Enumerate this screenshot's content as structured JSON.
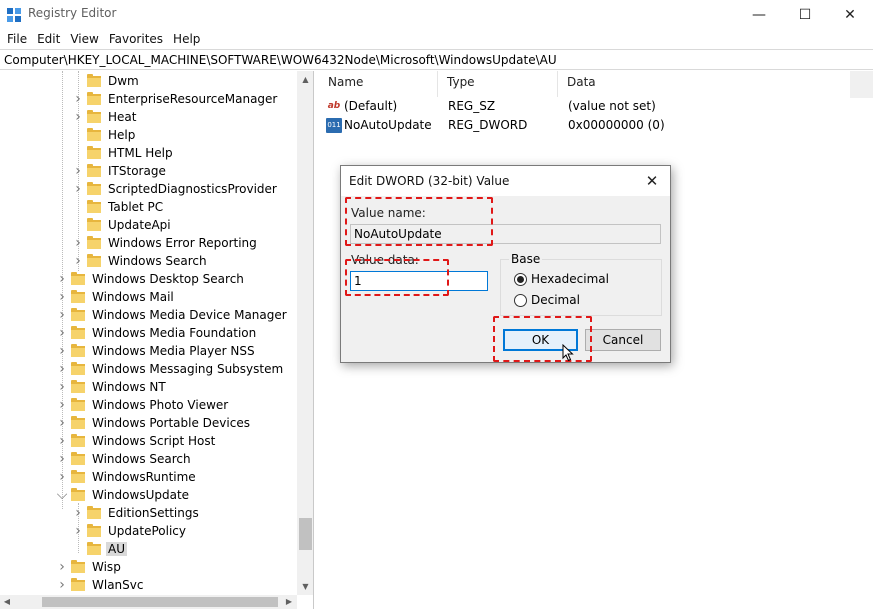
{
  "window": {
    "title": "Registry Editor",
    "minimize_glyph": "—",
    "maximize_glyph": "☐",
    "close_glyph": "✕"
  },
  "menu": [
    "File",
    "Edit",
    "View",
    "Favorites",
    "Help"
  ],
  "address": "Computer\\HKEY_LOCAL_MACHINE\\SOFTWARE\\WOW6432Node\\Microsoft\\WindowsUpdate\\AU",
  "tree": [
    {
      "label": "Dwm",
      "depth": 2,
      "expandable": false
    },
    {
      "label": "EnterpriseResourceManager",
      "depth": 2,
      "expandable": true
    },
    {
      "label": "Heat",
      "depth": 2,
      "expandable": true
    },
    {
      "label": "Help",
      "depth": 2,
      "expandable": false
    },
    {
      "label": "HTML Help",
      "depth": 2,
      "expandable": false
    },
    {
      "label": "ITStorage",
      "depth": 2,
      "expandable": true
    },
    {
      "label": "ScriptedDiagnosticsProvider",
      "depth": 2,
      "expandable": true
    },
    {
      "label": "Tablet PC",
      "depth": 2,
      "expandable": false
    },
    {
      "label": "UpdateApi",
      "depth": 2,
      "expandable": false
    },
    {
      "label": "Windows Error Reporting",
      "depth": 2,
      "expandable": true
    },
    {
      "label": "Windows Search",
      "depth": 2,
      "expandable": true
    },
    {
      "label": "Windows Desktop Search",
      "depth": 1,
      "expandable": true
    },
    {
      "label": "Windows Mail",
      "depth": 1,
      "expandable": true
    },
    {
      "label": "Windows Media Device Manager",
      "depth": 1,
      "expandable": true
    },
    {
      "label": "Windows Media Foundation",
      "depth": 1,
      "expandable": true
    },
    {
      "label": "Windows Media Player NSS",
      "depth": 1,
      "expandable": true
    },
    {
      "label": "Windows Messaging Subsystem",
      "depth": 1,
      "expandable": true
    },
    {
      "label": "Windows NT",
      "depth": 1,
      "expandable": true
    },
    {
      "label": "Windows Photo Viewer",
      "depth": 1,
      "expandable": true
    },
    {
      "label": "Windows Portable Devices",
      "depth": 1,
      "expandable": true
    },
    {
      "label": "Windows Script Host",
      "depth": 1,
      "expandable": true
    },
    {
      "label": "Windows Search",
      "depth": 1,
      "expandable": true
    },
    {
      "label": "WindowsRuntime",
      "depth": 1,
      "expandable": true
    },
    {
      "label": "WindowsUpdate",
      "depth": 1,
      "expandable": true,
      "expanded": true
    },
    {
      "label": "EditionSettings",
      "depth": 2,
      "expandable": true
    },
    {
      "label": "UpdatePolicy",
      "depth": 2,
      "expandable": true
    },
    {
      "label": "AU",
      "depth": 2,
      "expandable": false,
      "selected": true
    },
    {
      "label": "Wisp",
      "depth": 1,
      "expandable": true
    },
    {
      "label": "WlanSvc",
      "depth": 1,
      "expandable": true
    }
  ],
  "values": {
    "headers": {
      "name": "Name",
      "type": "Type",
      "data": "Data"
    },
    "rows": [
      {
        "icon": "string-value-icon",
        "icon_glyph": "ab",
        "name": "(Default)",
        "type": "REG_SZ",
        "data": "(value not set)"
      },
      {
        "icon": "binary-value-icon",
        "icon_glyph": "011",
        "name": "NoAutoUpdate",
        "type": "REG_DWORD",
        "data": "0x00000000 (0)"
      }
    ]
  },
  "dialog": {
    "title": "Edit DWORD (32-bit) Value",
    "close_glyph": "✕",
    "value_name_label": "Value name:",
    "value_name": "NoAutoUpdate",
    "value_data_label": "Value data:",
    "value_data": "1",
    "base_label": "Base",
    "base_options": [
      {
        "label": "Hexadecimal",
        "checked": true
      },
      {
        "label": "Decimal",
        "checked": false
      }
    ],
    "ok_label": "OK",
    "cancel_label": "Cancel"
  },
  "colors": {
    "annotation": "#e01818",
    "focus_accent": "#0078d7",
    "folder": "#f6d36b"
  }
}
